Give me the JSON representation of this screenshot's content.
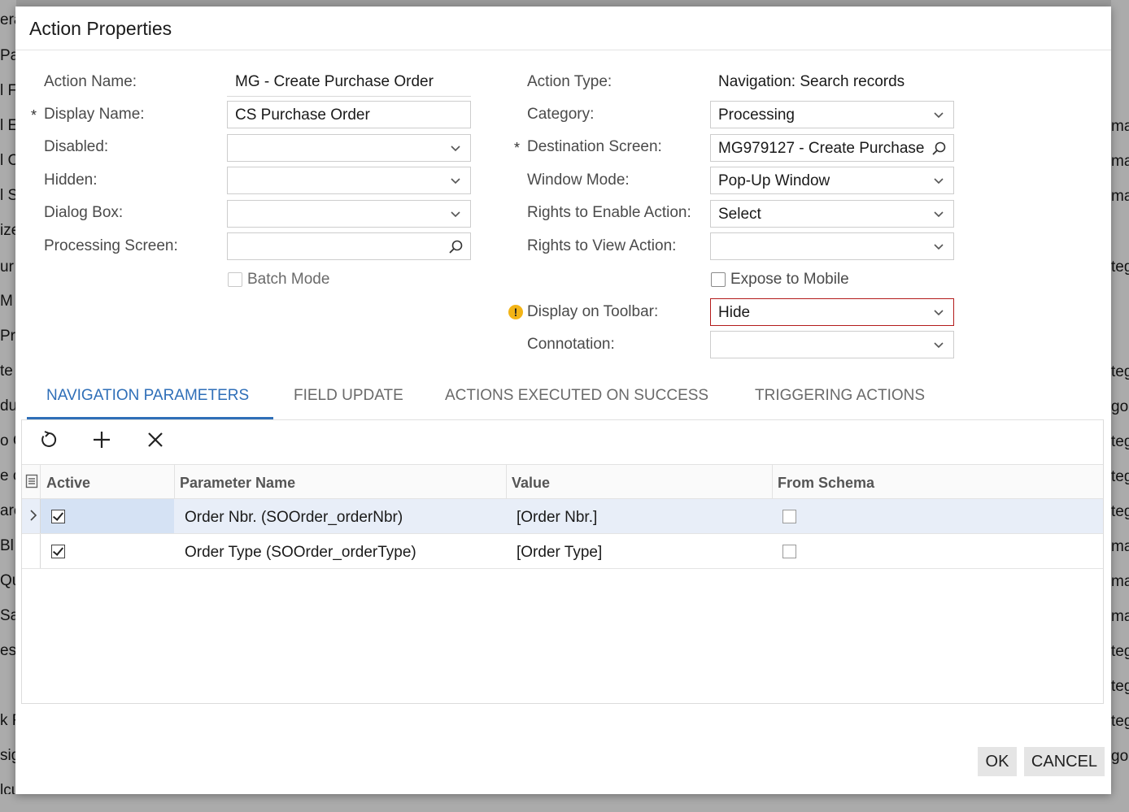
{
  "dialog": {
    "title": "Action Properties"
  },
  "left_form": {
    "action_name_label": "Action Name:",
    "action_name_value": "MG - Create Purchase Order",
    "display_name_label": "Display Name:",
    "display_name_value": "CS Purchase Order",
    "disabled_label": "Disabled:",
    "disabled_value": "",
    "hidden_label": "Hidden:",
    "hidden_value": "",
    "dialog_box_label": "Dialog Box:",
    "dialog_box_value": "",
    "processing_screen_label": "Processing Screen:",
    "processing_screen_value": "",
    "batch_mode_label": "Batch Mode",
    "batch_mode_checked": false
  },
  "right_form": {
    "action_type_label": "Action Type:",
    "action_type_value": "Navigation: Search records",
    "category_label": "Category:",
    "category_value": "Processing",
    "destination_screen_label": "Destination Screen:",
    "destination_screen_value": "MG979127 - Create Purchase",
    "window_mode_label": "Window Mode:",
    "window_mode_value": "Pop-Up Window",
    "rights_enable_label": "Rights to Enable Action:",
    "rights_enable_value": "Select",
    "rights_view_label": "Rights to View Action:",
    "rights_view_value": "",
    "expose_mobile_label": "Expose to Mobile",
    "expose_mobile_checked": false,
    "display_toolbar_label": "Display on Toolbar:",
    "display_toolbar_value": "Hide",
    "connotation_label": "Connotation:",
    "connotation_value": ""
  },
  "required_mark": "*",
  "warning_mark": "!",
  "tabs": [
    {
      "label": "NAVIGATION PARAMETERS",
      "active": true
    },
    {
      "label": "FIELD UPDATE",
      "active": false
    },
    {
      "label": "ACTIONS EXECUTED ON SUCCESS",
      "active": false
    },
    {
      "label": "TRIGGERING ACTIONS",
      "active": false
    }
  ],
  "toolbar": {
    "icons": [
      "refresh-icon",
      "add-icon",
      "delete-icon"
    ]
  },
  "grid": {
    "columns": [
      "Active",
      "Parameter Name",
      "Value",
      "From Schema"
    ],
    "rows": [
      {
        "active": true,
        "parameter_name": "Order Nbr. (SOOrder_orderNbr)",
        "value": "[Order Nbr.]",
        "from_schema": false,
        "selected": true
      },
      {
        "active": true,
        "parameter_name": "Order Type (SOOrder_orderType)",
        "value": "[Order Type]",
        "from_schema": false,
        "selected": false
      }
    ]
  },
  "buttons": {
    "ok": "OK",
    "cancel": "CANCEL"
  },
  "background": {
    "left_fragments": [
      "era",
      "Pa",
      "l F",
      "l E",
      "l C",
      "l S",
      "ize",
      "ur",
      " M",
      "Pr",
      "te",
      "du",
      "o C",
      "e c",
      "are",
      "Bl",
      "Qu",
      "Sa",
      "es:",
      "k F",
      "sig",
      "lcu"
    ],
    "right_fragments": [
      "ma",
      "ma",
      "ma",
      "teg",
      "teg",
      "gor",
      "teg",
      "teg",
      "teg",
      "ma",
      "ma",
      "ma",
      "teg",
      "teg",
      "teg",
      "gor"
    ]
  },
  "colors": {
    "accent": "#2f6fb8",
    "warning": "#f3b416",
    "error_border": "#b31b1b",
    "selected_row": "#e8eef8"
  }
}
